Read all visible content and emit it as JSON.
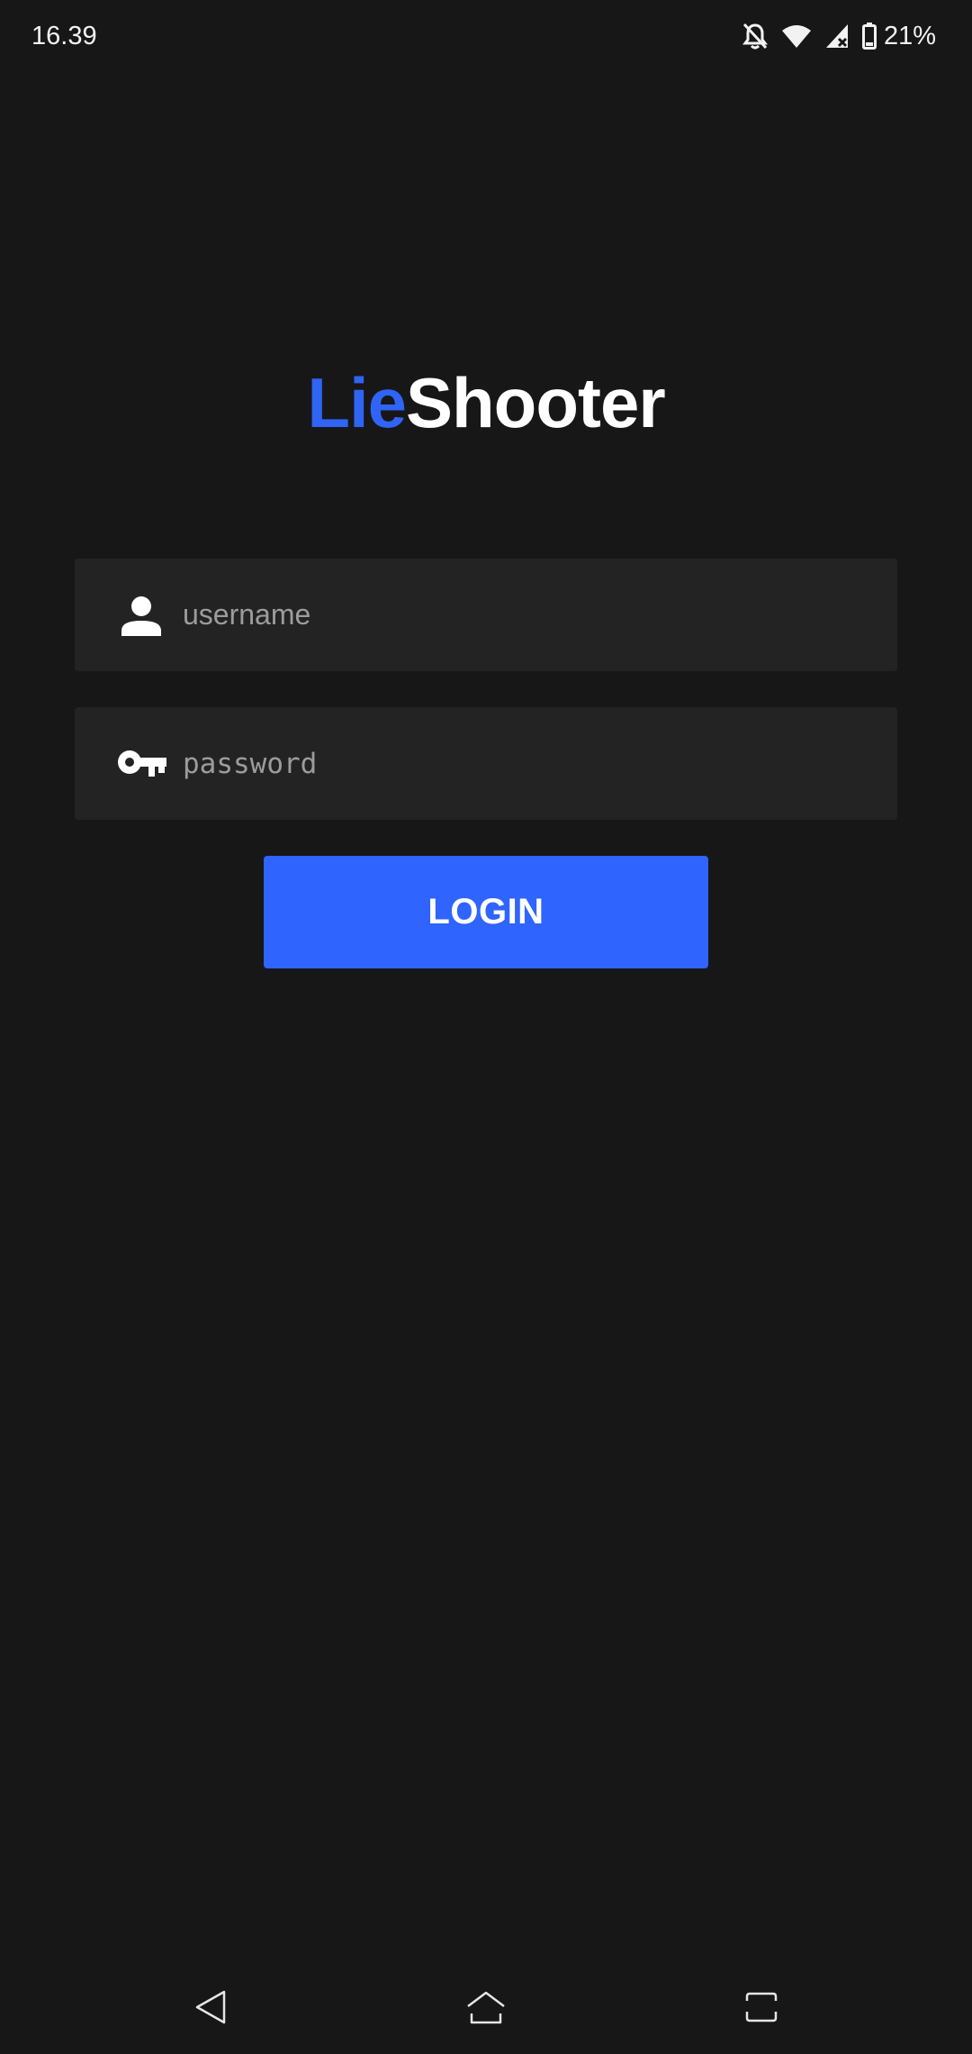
{
  "status_bar": {
    "time": "16.39",
    "battery_percent": "21%",
    "icons": [
      "notifications-off-icon",
      "wifi-icon",
      "signal-icon",
      "battery-icon"
    ]
  },
  "logo": {
    "part_1": "Lie",
    "part_2": "Shooter",
    "part_1_color": "#2f64f5",
    "part_2_color": "#ffffff"
  },
  "form": {
    "username": {
      "value": "",
      "placeholder": "username",
      "icon": "person-icon"
    },
    "password": {
      "value": "",
      "placeholder": "password",
      "icon": "key-icon"
    },
    "login_label": "LOGIN",
    "accent_color": "#2f64ff"
  },
  "nav_bar": {
    "icons": [
      "back-icon",
      "home-icon",
      "recents-icon"
    ]
  }
}
